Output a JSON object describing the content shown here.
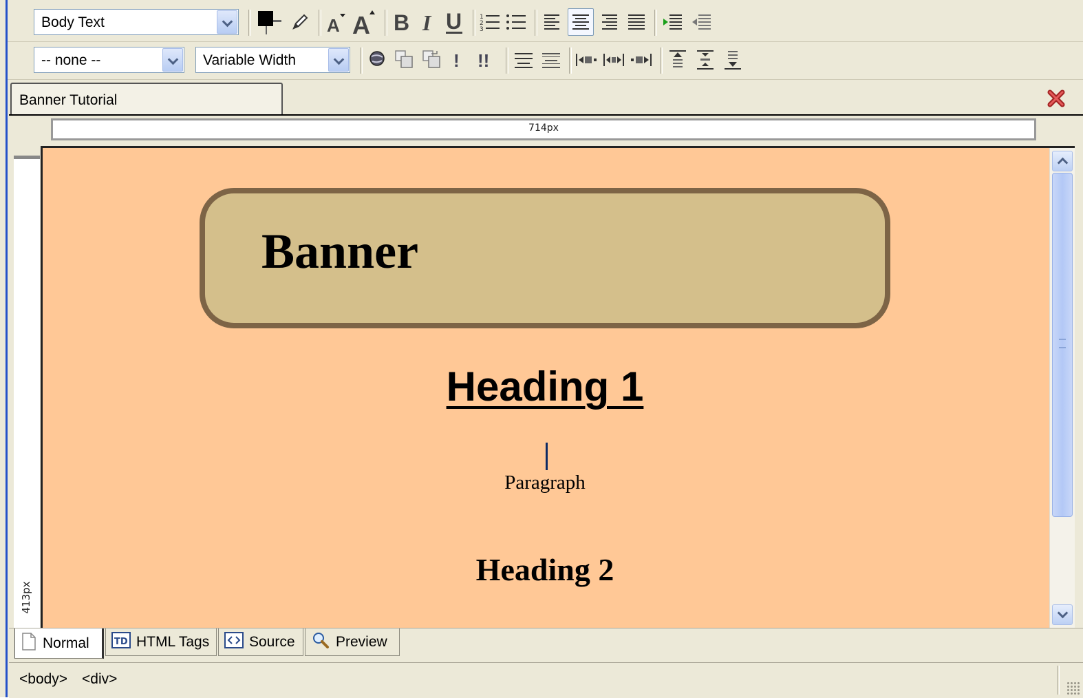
{
  "toolbar": {
    "paragraph_style": "Body Text",
    "class_style": "-- none --",
    "font_face": "Variable Width"
  },
  "document": {
    "tab_title": "Banner Tutorial"
  },
  "rulers": {
    "width_label": "714px",
    "height_label": "413px"
  },
  "content": {
    "banner": "Banner",
    "heading1": "Heading 1",
    "paragraph": "Paragraph",
    "heading2": "Heading 2"
  },
  "view_tabs": [
    {
      "label": "Normal",
      "icon": "page-icon",
      "active": true
    },
    {
      "label": "HTML Tags",
      "icon": "td-tag-icon",
      "active": false
    },
    {
      "label": "Source",
      "icon": "source-code-icon",
      "active": false
    },
    {
      "label": "Preview",
      "icon": "magnifier-icon",
      "active": false
    }
  ],
  "status": {
    "tag1": "<body>",
    "tag2": "<div>"
  },
  "colors": {
    "canvas_background": "#ffc896",
    "banner_fill": "#d4bf8b",
    "banner_border": "#7d6446",
    "window_chrome": "#ece9d8"
  }
}
